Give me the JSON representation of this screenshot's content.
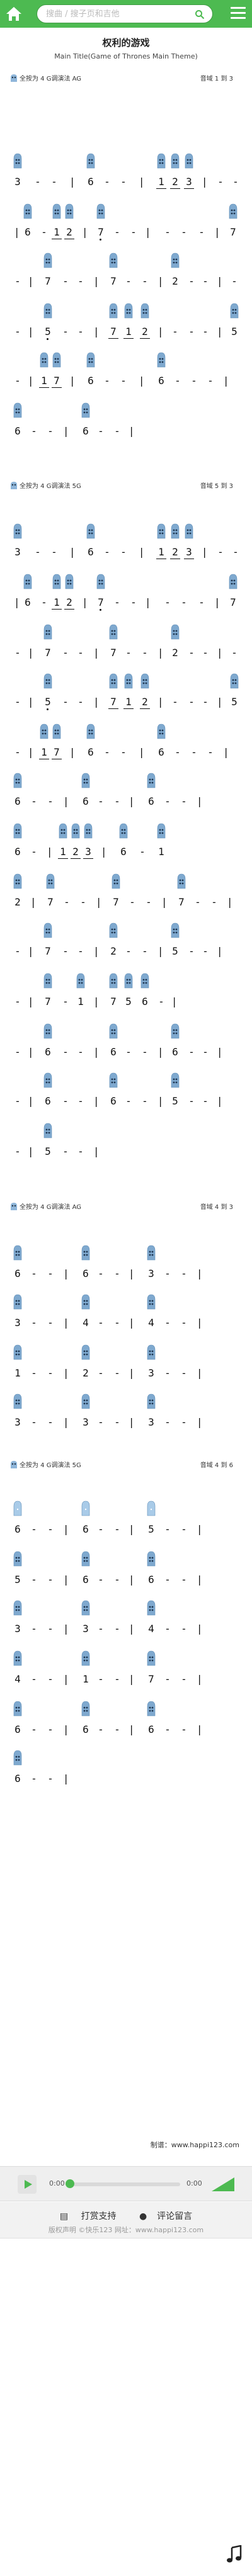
{
  "header": {
    "search_placeholder": "搜曲 / 搜子页和吉他",
    "brand_color": "#4dba51"
  },
  "score": {
    "title": "权利的游戏",
    "subtitle": "Main Title(Game of Thrones Main Theme)",
    "sections": [
      {
        "info_left": "全按为 4    G调演法  AG",
        "info_right": "音域  1 到 3"
      },
      {
        "info_left": "全按为 4    G调演法  5G",
        "info_right": "音域  5 到 3"
      },
      {
        "info_left": "全按为 4    G调演法  AG",
        "info_right": "音域  4 到 3"
      },
      {
        "info_left": "全按为 4    G调演法  5G",
        "info_right": "音域  4 到 6"
      }
    ],
    "credit": "制谱：www.happi123.com"
  },
  "player": {
    "current_time": "0:00",
    "total_time": "0:00",
    "progress": 0
  },
  "footer": {
    "donate": "打赏支持",
    "comment": "评论留言",
    "copyright": "版权声明   ©快乐123  网址：www.happi123.com"
  }
}
